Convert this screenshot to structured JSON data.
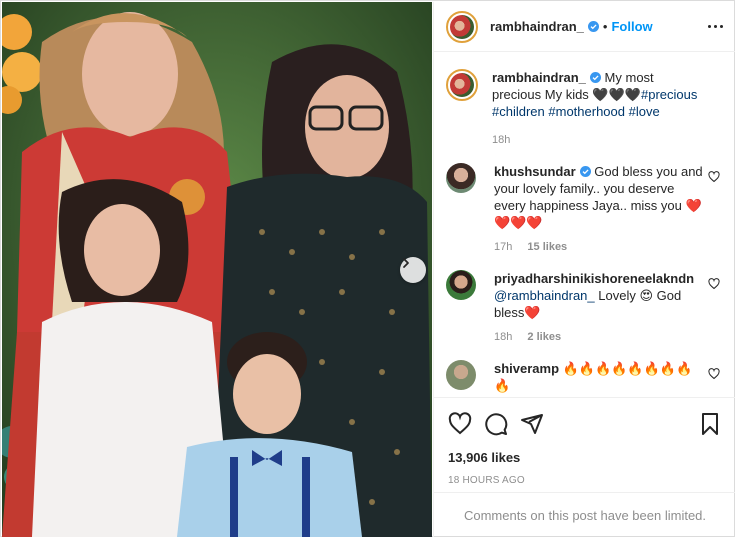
{
  "post": {
    "username": "rambhaindran_",
    "verified": true,
    "follow_label": "Follow",
    "more_icon": "more-options-icon",
    "next_arrow_icon": "chevron-right-icon"
  },
  "caption": {
    "username": "rambhaindran_",
    "text_start": "My most precious My kids ",
    "hearts": "🖤🖤🖤",
    "hashtags": [
      "#precious",
      "#children",
      "#motherhood",
      "#love"
    ],
    "time": "18h"
  },
  "comments": [
    {
      "username": "khushsundar",
      "verified": true,
      "text": "God bless you and your lovely family.. you deserve every happiness Jaya.. miss you ",
      "emoji": "❤️ ❤️❤️❤️",
      "time": "17h",
      "likes": "15 likes"
    },
    {
      "username": "priyadharshinikishoreneelakndn",
      "mention": "@rambhaindran_",
      "text": " Lovely 😍 God bless",
      "emoji": "❤️",
      "time": "18h",
      "likes": "2 likes"
    },
    {
      "username": "shiveramp",
      "text": "🔥🔥🔥🔥🔥🔥🔥🔥🔥"
    }
  ],
  "engagement": {
    "likes": "13,906 likes",
    "time": "18 HOURS AGO"
  },
  "footer": {
    "limited_text": "Comments on this post have been limited."
  },
  "colors": {
    "accent": "#0095f6",
    "text": "#262626",
    "muted": "#8e8e8e",
    "heart": "#ed1c3a"
  }
}
